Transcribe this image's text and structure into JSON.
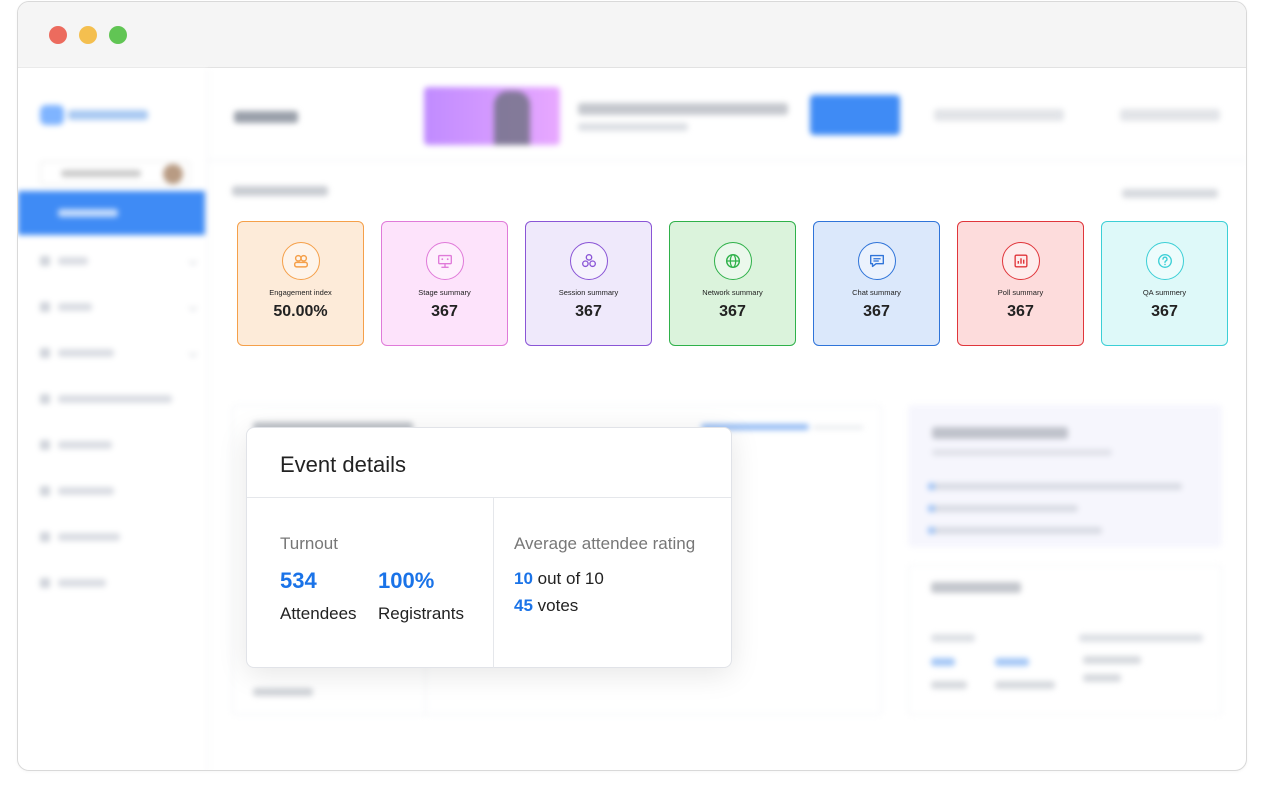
{
  "window": {
    "controls": [
      "close",
      "minimize",
      "maximize"
    ]
  },
  "stat_cards": [
    {
      "label": "Engagement index",
      "value": "50.00%",
      "icon": "engagement-icon",
      "color": "#f5a04a",
      "bg": "#fdebd9"
    },
    {
      "label": "Stage summary",
      "value": "367",
      "icon": "stage-icon",
      "color": "#e07ad9",
      "bg": "#fde3fb"
    },
    {
      "label": "Session summary",
      "value": "367",
      "icon": "session-icon",
      "color": "#8a55d6",
      "bg": "#efe9fb"
    },
    {
      "label": "Network summary",
      "value": "367",
      "icon": "globe-icon",
      "color": "#2fb14a",
      "bg": "#dbf3dc"
    },
    {
      "label": "Chat summary",
      "value": "367",
      "icon": "chat-icon",
      "color": "#2f74d9",
      "bg": "#dbe8fb"
    },
    {
      "label": "Poll summary",
      "value": "367",
      "icon": "poll-icon",
      "color": "#e0363b",
      "bg": "#fddcdc"
    },
    {
      "label": "QA summery",
      "value": "367",
      "icon": "question-icon",
      "color": "#3ccfd6",
      "bg": "#def9f9"
    }
  ],
  "event_details": {
    "title": "Event details",
    "turnout_label": "Turnout",
    "attendees_value": "534",
    "attendees_label": "Attendees",
    "registrants_value": "100%",
    "registrants_label": "Registrants",
    "rating_label": "Average attendee rating",
    "rating_value": "10",
    "rating_suffix": " out of 10",
    "votes_value": "45",
    "votes_suffix": " votes"
  }
}
